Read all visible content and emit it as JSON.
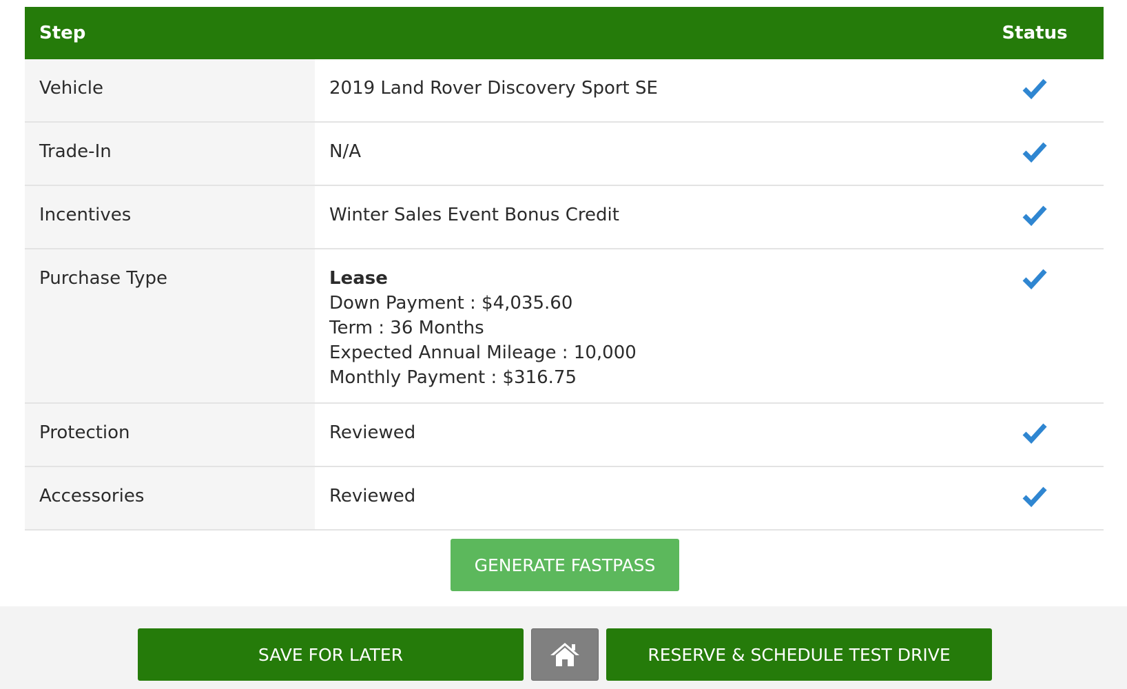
{
  "table": {
    "headers": {
      "step": "Step",
      "status": "Status"
    },
    "rows": [
      {
        "step": "Vehicle",
        "detail": "2019 Land Rover Discovery Sport SE",
        "status_icon": "check-icon"
      },
      {
        "step": "Trade-In",
        "detail": "N/A",
        "status_icon": "check-icon"
      },
      {
        "step": "Incentives",
        "detail": "Winter Sales Event Bonus Credit",
        "status_icon": "check-icon"
      },
      {
        "step": "Purchase Type",
        "detail_title": "Lease",
        "detail_lines": [
          "Down Payment : $4,035.60",
          "Term : 36 Months",
          "Expected Annual Mileage : 10,000",
          "Monthly Payment : $316.75"
        ],
        "status_icon": "check-icon"
      },
      {
        "step": "Protection",
        "detail": "Reviewed",
        "status_icon": "check-icon"
      },
      {
        "step": "Accessories",
        "detail": "Reviewed",
        "status_icon": "check-icon"
      }
    ]
  },
  "actions": {
    "generate_fastpass": "GENERATE FASTPASS",
    "save_for_later": "SAVE FOR LATER",
    "home_icon": "home-icon",
    "reserve": "RESERVE & SCHEDULE TEST DRIVE"
  },
  "colors": {
    "header_green": "#257b0a",
    "fastpass_green": "#5cb85c",
    "check_blue": "#2f86d1",
    "home_gray": "#808080"
  }
}
